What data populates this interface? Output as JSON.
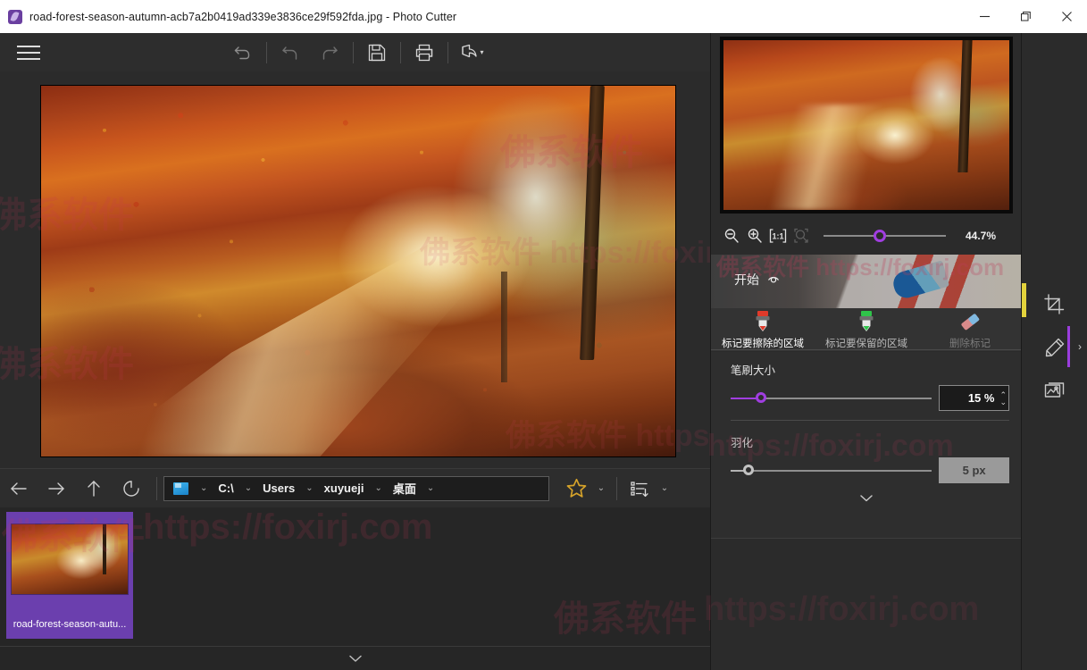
{
  "window": {
    "title": "road-forest-season-autumn-acb7a2b0419ad339e3836ce29f592fda.jpg - Photo Cutter",
    "app_icon": "photo-cutter-icon",
    "minimize": "─",
    "maximize": "❐",
    "close": "✕"
  },
  "toolbar": {
    "menu": "hamburger-menu",
    "revert": "revert-icon",
    "undo": "undo-icon",
    "redo": "redo-icon",
    "save": "save-icon",
    "print": "print-icon",
    "share": "share-icon",
    "share_caret": "▾"
  },
  "canvas": {
    "image_alt": "road-forest-season-autumn"
  },
  "filenav": {
    "back": "back-arrow-icon",
    "forward": "forward-arrow-icon",
    "up": "up-arrow-icon",
    "refresh": "refresh-icon",
    "drive_icon": "computer-icon",
    "crumbs": [
      "C:\\",
      "Users",
      "xuyueji",
      "桌面"
    ],
    "crumb_chevron": "⌄",
    "favorites": "star-icon",
    "favorites_caret": "⌄",
    "sort": "sort-list-icon",
    "sort_caret": "⌄"
  },
  "browser": {
    "items": [
      {
        "label": "road-forest-season-autu...",
        "selected": true
      }
    ],
    "collapse": "⌄"
  },
  "right_panel": {
    "preview_alt": "road-forest-season-autumn preview",
    "zoom": {
      "zoom_out": "zoom-out-icon",
      "zoom_in": "zoom-in-icon",
      "actual_size": "1:1",
      "fit_window": "fit-to-window-icon",
      "value": "44.7%",
      "slider_percent": 41
    },
    "collapse_up": "⌃",
    "banner": {
      "label": "开始",
      "badge_icon": "eye-icon"
    },
    "tools": [
      {
        "label": "标记要擦除的区域",
        "icon": "red-marker-icon",
        "state": "active"
      },
      {
        "label": "标记要保留的区域",
        "icon": "green-marker-icon",
        "state": "normal"
      },
      {
        "label": "删除标记",
        "icon": "eraser-icon",
        "state": "disabled"
      }
    ],
    "settings": [
      {
        "label": "笔刷大小",
        "value": "15 %",
        "percent": 15,
        "control": "spinner",
        "disabled": false
      },
      {
        "label": "羽化",
        "value": "5 px",
        "percent": 8,
        "control": "readonly",
        "disabled": true
      }
    ],
    "section_chevron": "⌄",
    "spin_up": "⌃",
    "spin_down": "⌄"
  },
  "rail": {
    "items": [
      {
        "name": "crop-tool",
        "icon": "crop-icon",
        "active": false
      },
      {
        "name": "cutter-tool",
        "icon": "cutter-pen-icon",
        "active": true
      },
      {
        "name": "photos-tool",
        "icon": "photos-icon",
        "active": false
      }
    ],
    "expand": "›"
  },
  "watermarks": {
    "cn": "佛系软件",
    "url": "https://foxirj.com",
    "full": "佛系软件 https://foxirj.com"
  },
  "colors": {
    "accent": "#a03ee0",
    "selection": "#6b3fae",
    "titlebar": "#ffffff",
    "panel": "#2b2b2b",
    "marker_red": "#e03a2a",
    "marker_green": "#2fc34a",
    "star": "#d6a32a"
  }
}
